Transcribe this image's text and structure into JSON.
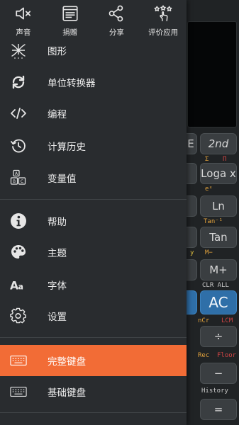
{
  "top_actions": [
    {
      "label": "声音",
      "icon": "sound-off-icon"
    },
    {
      "label": "捐赠",
      "icon": "donate-icon"
    },
    {
      "label": "分享",
      "icon": "share-icon"
    },
    {
      "label": "评价应用",
      "icon": "rate-app-icon"
    }
  ],
  "menu": {
    "graph": "图形",
    "unit_converter": "单位转换器",
    "programming": "编程",
    "history": "计算历史",
    "variables": "变量值",
    "help": "帮助",
    "theme": "主题",
    "font": "字体",
    "settings": "设置",
    "full_keyboard": "完整键盘",
    "basic_keyboard": "基础键盘"
  },
  "calculator_bg": {
    "keys": {
      "e": "E",
      "second": "2nd",
      "loga": "Loga x",
      "ln": "Ln",
      "tan": "Tan",
      "mplus": "M+",
      "ac": "AC",
      "divide": "÷",
      "minus": "−",
      "equals": "="
    },
    "labels": {
      "ex": "eˣ",
      "tan_inv": "Tan⁻¹",
      "m_minus": "M−",
      "clr_all": "CLR ALL",
      "ncr": "nCr",
      "lcm": "LCM",
      "rec": "Rec",
      "floor": "Floor",
      "history": "History",
      "sigma": "Σ",
      "pi": "Π",
      "y": "y"
    }
  },
  "colors": {
    "accent": "#f26c36",
    "drawer_bg": "#292c2f",
    "key_blue": "#2f6fa8",
    "label_orange": "#e2a23c",
    "label_red": "#d24545"
  }
}
